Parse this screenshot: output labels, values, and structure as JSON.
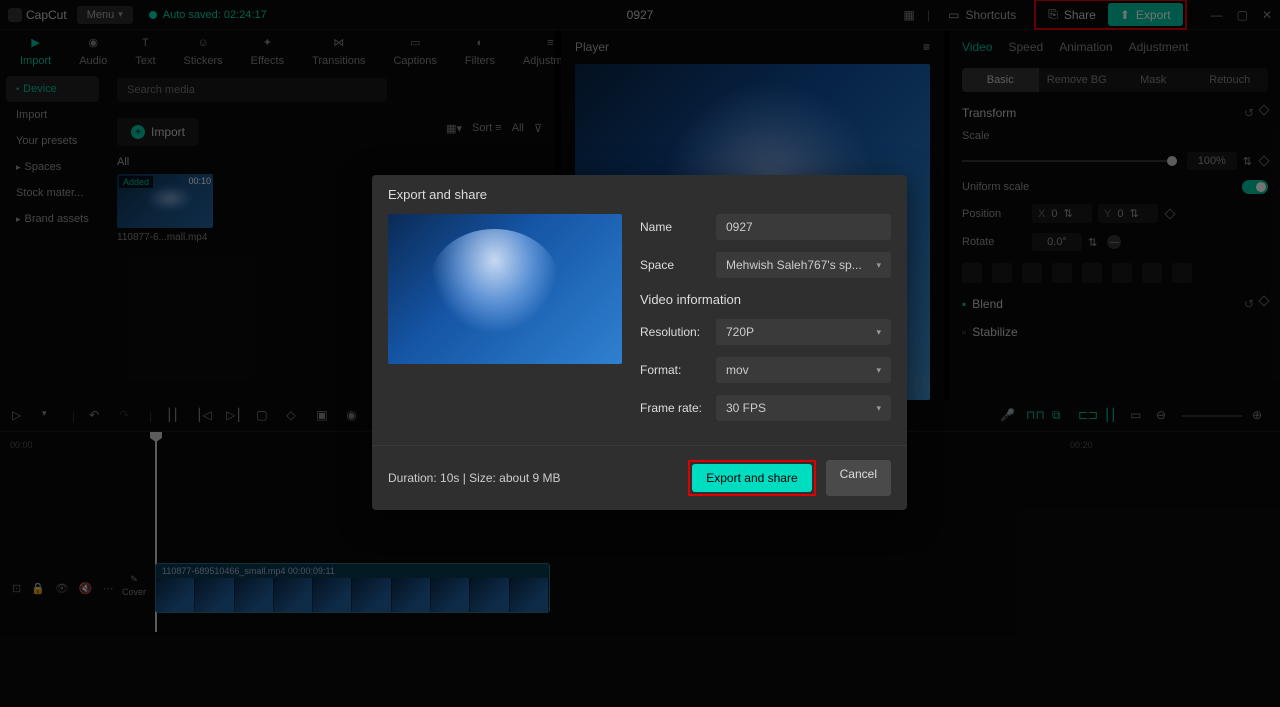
{
  "app": {
    "name": "CapCut",
    "menu": "Menu",
    "autosave": "Auto saved: 02:24:17",
    "title": "0927"
  },
  "topbar": {
    "shortcuts": "Shortcuts",
    "share": "Share",
    "export": "Export"
  },
  "tabs": [
    "Import",
    "Audio",
    "Text",
    "Stickers",
    "Effects",
    "Transitions",
    "Captions",
    "Filters",
    "Adjustment"
  ],
  "sidebar": {
    "items": [
      "Device",
      "Import",
      "Your presets",
      "Spaces",
      "Stock mater...",
      "Brand assets"
    ]
  },
  "media": {
    "search_placeholder": "Search media",
    "import": "Import",
    "sort": "Sort",
    "all_btn": "All",
    "all_label": "All",
    "thumb_tag": "Added",
    "thumb_dur": "00:10",
    "thumb_name": "110877-6...mall.mp4"
  },
  "player": {
    "label": "Player"
  },
  "props": {
    "tabs": [
      "Video",
      "Speed",
      "Animation",
      "Adjustment"
    ],
    "subtabs": [
      "Basic",
      "Remove BG",
      "Mask",
      "Retouch"
    ],
    "transform": "Transform",
    "scale": "Scale",
    "scale_val": "100%",
    "uniform": "Uniform scale",
    "position": "Position",
    "x": "X",
    "xv": "0",
    "y": "Y",
    "yv": "0",
    "rotate": "Rotate",
    "rotate_val": "0.0°",
    "blend": "Blend",
    "stabilize": "Stabilize"
  },
  "timeline": {
    "marks": [
      "00:00",
      "|",
      "|",
      "|",
      "|",
      "00:20",
      "00:20"
    ],
    "clip_name": "110877-689510466_small.mp4  00:00:09:11",
    "cover": "Cover"
  },
  "modal": {
    "title": "Export and share",
    "name_label": "Name",
    "name_val": "0927",
    "space_label": "Space",
    "space_val": "Mehwish Saleh767's sp...",
    "video_info": "Video information",
    "res_label": "Resolution:",
    "res_val": "720P",
    "fmt_label": "Format:",
    "fmt_val": "mov",
    "fps_label": "Frame rate:",
    "fps_val": "30 FPS",
    "footer_info": "Duration: 10s | Size: about 9 MB",
    "export_btn": "Export and share",
    "cancel_btn": "Cancel"
  }
}
